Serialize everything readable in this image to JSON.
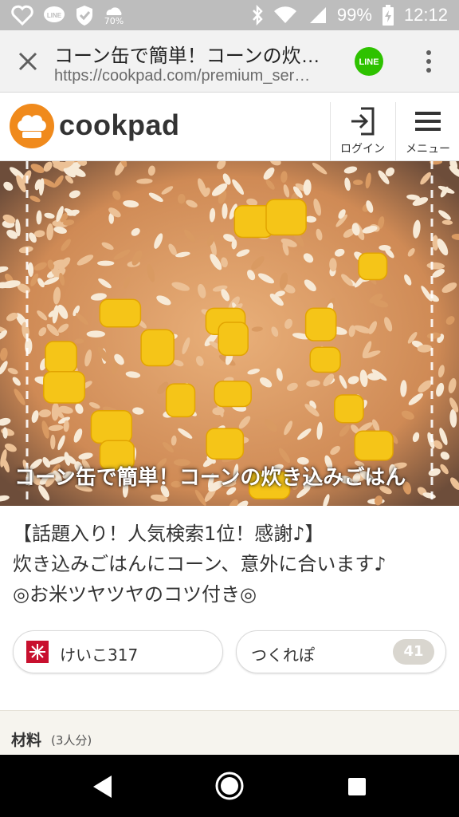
{
  "status_bar": {
    "battery": "99%",
    "time": "12:12",
    "icons": [
      "heart-outline-icon",
      "line-notification-icon",
      "shield-check-icon",
      "weather-icon",
      "bluetooth-icon",
      "wifi-icon",
      "signal-icon",
      "battery-charging-icon"
    ],
    "weather_text": "70%"
  },
  "browser": {
    "page_title": "コーン缶で簡単！コーンの炊…",
    "url": "https://cookpad.com/premium_ser…",
    "line_label": "LINE"
  },
  "site_header": {
    "logo_text": "cookpad",
    "login_label": "ログイン",
    "menu_label": "メニュー"
  },
  "hero": {
    "caption": "コーン缶で簡単！コーンの炊き込みごはん"
  },
  "description": {
    "lines": [
      "【話題入り！人気検索1位！感謝♪】",
      "炊き込みごはんにコーン、意外に合います♪",
      "◎お米ツヤツヤのコツ付き◎"
    ]
  },
  "author": {
    "name": "けいこ317"
  },
  "tsukurepo": {
    "label": "つくれぽ",
    "count": "41"
  },
  "ingredients": {
    "heading": "材料",
    "servings": "(3人分)"
  },
  "colors": {
    "brand_orange": "#f08a1c",
    "line_green": "#2ec200",
    "status_gray": "#bdbdbd"
  }
}
